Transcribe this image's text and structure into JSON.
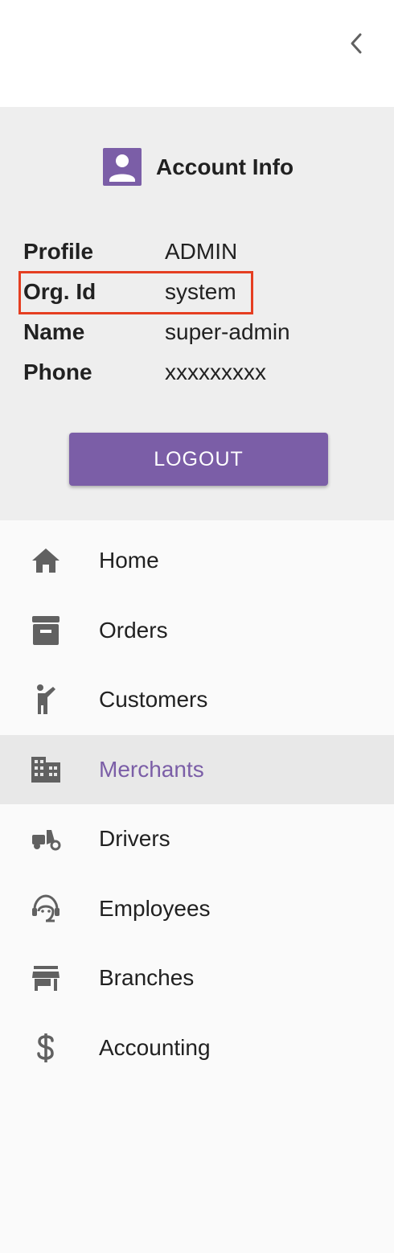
{
  "account": {
    "title": "Account Info",
    "rows": [
      {
        "label": "Profile",
        "value": "ADMIN"
      },
      {
        "label": "Org. Id",
        "value": "system"
      },
      {
        "label": "Name",
        "value": "super-admin"
      },
      {
        "label": "Phone",
        "value": "xxxxxxxxx"
      }
    ],
    "logout_label": "LOGOUT"
  },
  "nav": {
    "items": [
      {
        "label": "Home",
        "icon": "home-icon"
      },
      {
        "label": "Orders",
        "icon": "archive-box-icon"
      },
      {
        "label": "Customers",
        "icon": "person-waving-icon"
      },
      {
        "label": "Merchants",
        "icon": "building-icon",
        "active": true
      },
      {
        "label": "Drivers",
        "icon": "moped-icon"
      },
      {
        "label": "Employees",
        "icon": "headset-agent-icon"
      },
      {
        "label": "Branches",
        "icon": "store-icon"
      },
      {
        "label": "Accounting",
        "icon": "dollar-icon"
      }
    ]
  },
  "colors": {
    "accent": "#7b5ea7",
    "highlight_border": "#e53e21",
    "account_bg": "#eeeeee",
    "active_bg": "#e8e8e8",
    "icon": "#616161"
  }
}
